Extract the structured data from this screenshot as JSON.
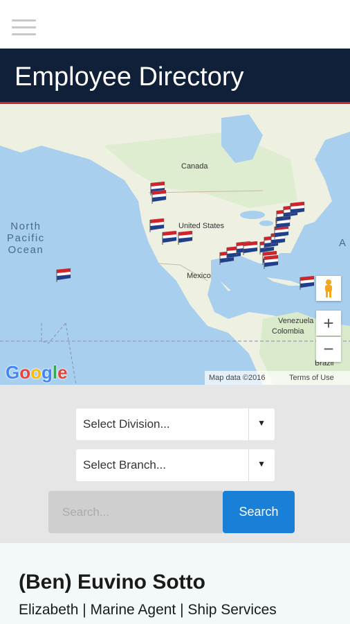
{
  "header": {
    "menu_icon": "hamburger-menu-icon",
    "title": "Employee Directory"
  },
  "map": {
    "labels": {
      "canada": "Canada",
      "united_states": "United States",
      "mexico": "Mexico",
      "venezuela": "Venezuela",
      "colombia": "Colombia",
      "brazil": "Brazil",
      "north_pacific_ocean": "North\nPacific\nOcean",
      "atlantic_partial": "A"
    },
    "google_logo": "Google",
    "map_data": "Map data ©2016",
    "terms": "Terms of Use",
    "zoom_in_label": "+",
    "zoom_out_label": "−",
    "pegman_icon": "street-view-pegman-icon",
    "marker_icon": "company-flag-marker-icon",
    "colors": {
      "water": "#a9cfee",
      "land": "#eef0e2",
      "flag_red": "#d0242a",
      "flag_blue": "#1f3e8c"
    }
  },
  "filters": {
    "division": {
      "selected": "Select Division...",
      "arrow": "▼"
    },
    "branch": {
      "selected": "Select Branch...",
      "arrow": "▼"
    },
    "search": {
      "placeholder": "Search...",
      "value": "",
      "button_label": "Search"
    },
    "colors": {
      "search_button": "#1a7fd6"
    }
  },
  "results": [
    {
      "name": "(Ben) Euvino Sotto",
      "detail": "Elizabeth | Marine Agent | Ship Services"
    }
  ],
  "theme": {
    "title_bar": "#0f2038",
    "accent_red": "#d0242a"
  }
}
